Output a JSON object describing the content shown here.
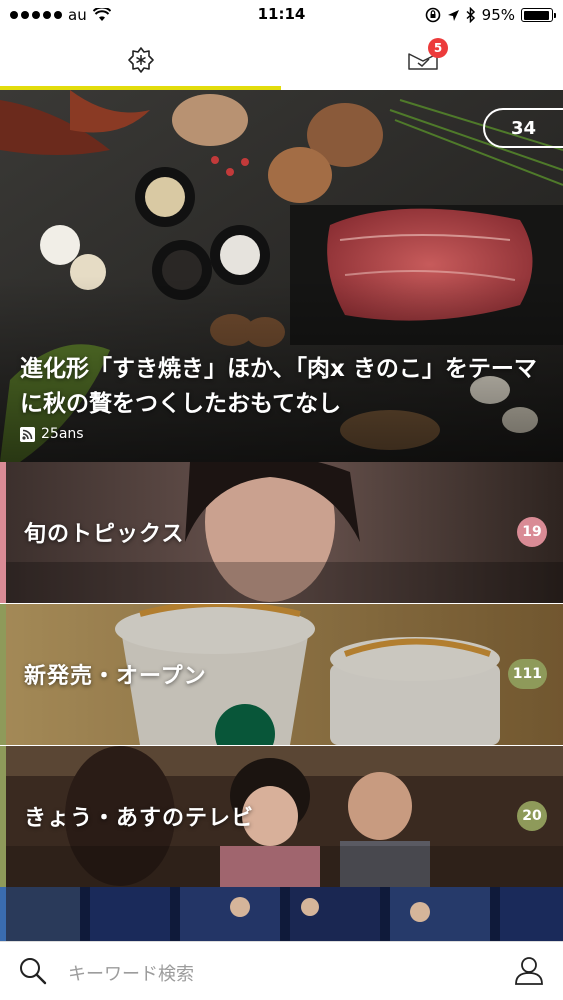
{
  "status_bar": {
    "carrier": "au",
    "time": "11:14",
    "battery": "95%",
    "battery_level": 0.95
  },
  "tabs": {
    "home_icon": "flower-icon",
    "inbox_icon": "mail-check-icon",
    "inbox_badge": "5",
    "accent_color": "#e2dc0c"
  },
  "hero": {
    "count": "34",
    "title": "進化形「すき焼き」ほか、「肉x きのこ」をテーマに秋の贅をつくしたおもてなし",
    "source": "25ans"
  },
  "categories": [
    {
      "label": "旬のトピックス",
      "count": "19",
      "accent": "#d98b95",
      "badge_color": "#d98b95"
    },
    {
      "label": "新発売・オープン",
      "count": "111",
      "accent": "#8e9a5a",
      "badge_color": "#8e9a5a"
    },
    {
      "label": "きょう・あすのテレビ",
      "count": "20",
      "accent": "#8e9a5a",
      "badge_color": "#8e9a5a"
    },
    {
      "label": "",
      "count": "",
      "accent": "#3a6cb0",
      "badge_color": "#3a6cb0"
    }
  ],
  "search": {
    "placeholder": "キーワード検索"
  }
}
